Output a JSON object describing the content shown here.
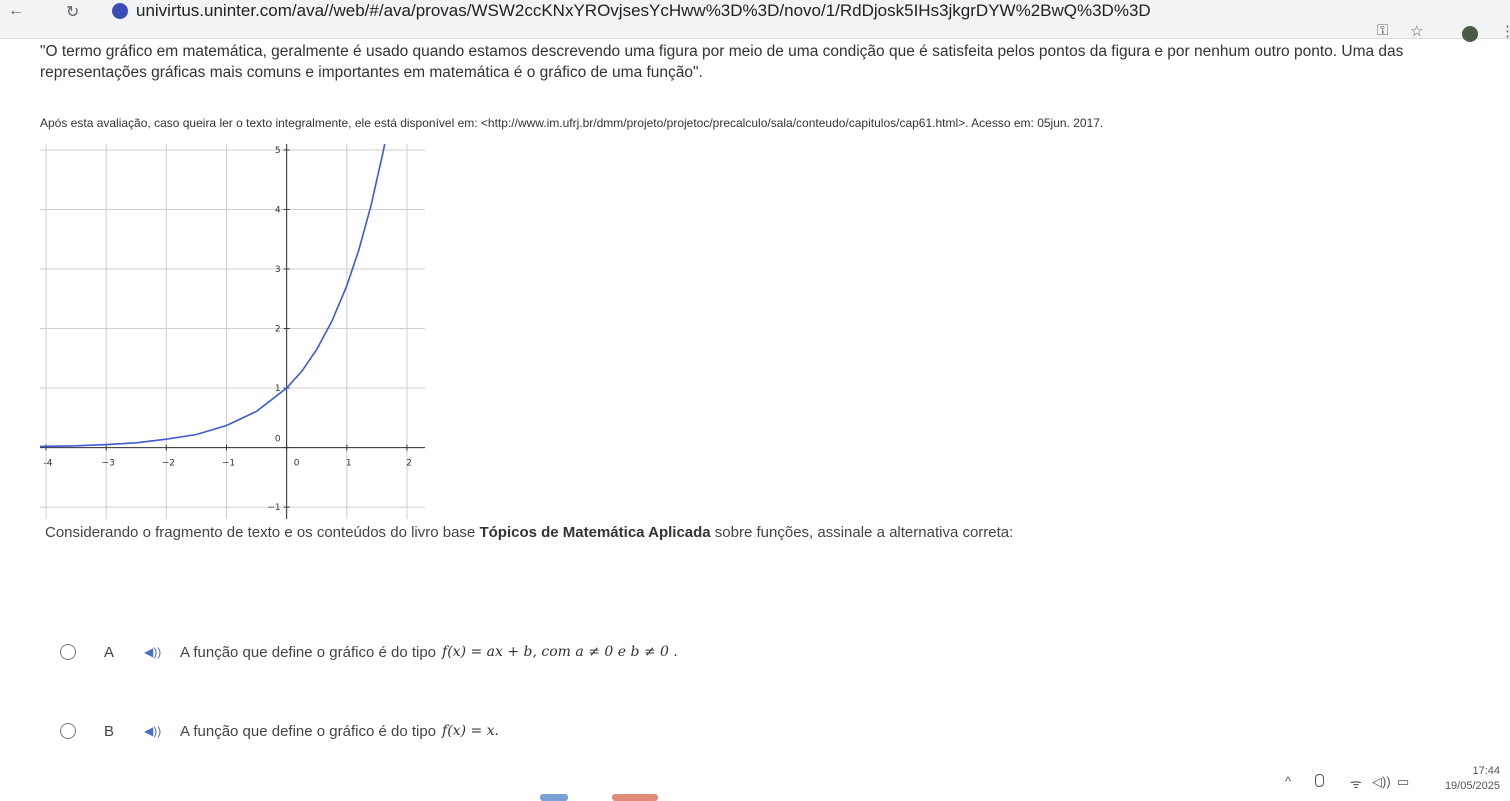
{
  "browser": {
    "url": "univirtus.uninter.com/ava//web/#/ava/provas/WSW2ccKNxYROvjsesYcHww%3D%3D/novo/1/RdDjosk5IHs3jkgrDYW%2BwQ%3D%3D",
    "back_icon": "←",
    "reload_icon": "↻",
    "key_icon": "⚿",
    "star_icon": "☆",
    "menu_icon": "⋮"
  },
  "intro": {
    "quote": "\"O termo gráfico em matemática, geralmente é usado quando estamos descrevendo uma figura por meio de uma condição que é satisfeita pelos pontos da figura e por nenhum outro ponto. Uma das representações gráficas mais comuns e importantes em matemática é o gráfico de uma função\".",
    "source": "Após esta avaliação, caso queira ler o texto integralmente, ele está disponível em: <http://www.im.ufrj.br/dmm/projeto/projetoc/precalculo/sala/conteudo/capitulos/cap61.html>. Acesso em: 05jun. 2017."
  },
  "graph": {
    "x_ticks": [
      {
        "value": -4,
        "label": "-4"
      },
      {
        "value": -3,
        "label": "−3"
      },
      {
        "value": -2,
        "label": "−2"
      },
      {
        "value": -1,
        "label": "−1"
      },
      {
        "value": 0,
        "label": "0"
      },
      {
        "value": 1,
        "label": "1"
      },
      {
        "value": 2,
        "label": "2"
      }
    ],
    "y_ticks": [
      {
        "value": -1,
        "label": "−1"
      },
      {
        "value": 0,
        "label": "0"
      },
      {
        "value": 1,
        "label": "1"
      },
      {
        "value": 2,
        "label": "2"
      },
      {
        "value": 3,
        "label": "3"
      },
      {
        "value": 4,
        "label": "4"
      },
      {
        "value": 5,
        "label": "5"
      }
    ],
    "xlim": [
      -4.1,
      2.3
    ],
    "ylim": [
      -1.2,
      5.1
    ],
    "curve_color": "#3d5bd6",
    "curve_samples": [
      {
        "x": -4.1,
        "y": 0.02
      },
      {
        "x": -3.5,
        "y": 0.03
      },
      {
        "x": -3.0,
        "y": 0.05
      },
      {
        "x": -2.5,
        "y": 0.08
      },
      {
        "x": -2.0,
        "y": 0.14
      },
      {
        "x": -1.5,
        "y": 0.22
      },
      {
        "x": -1.0,
        "y": 0.37
      },
      {
        "x": -0.5,
        "y": 0.61
      },
      {
        "x": 0.0,
        "y": 1.0
      },
      {
        "x": 0.25,
        "y": 1.28
      },
      {
        "x": 0.5,
        "y": 1.65
      },
      {
        "x": 0.75,
        "y": 2.12
      },
      {
        "x": 1.0,
        "y": 2.72
      },
      {
        "x": 1.2,
        "y": 3.32
      },
      {
        "x": 1.4,
        "y": 4.06
      },
      {
        "x": 1.6,
        "y": 4.95
      },
      {
        "x": 1.63,
        "y": 5.1
      }
    ]
  },
  "question": {
    "prefix": "Considerando o fragmento de texto e os conteúdos do livro base ",
    "book": "Tópicos de Matemática Aplicada",
    "suffix": " sobre funções, assinale a alternativa correta:"
  },
  "options": [
    {
      "letter": "A",
      "speaker": "◀))",
      "text": "A função que define o gráfico é do tipo",
      "formula": "f(x) = ax + b, com a ≠ 0 e b ≠ 0 ."
    },
    {
      "letter": "B",
      "speaker": "◀))",
      "text": "A função que define o gráfico é do tipo",
      "formula": "f(x) = x."
    }
  ],
  "taskbar": {
    "time": "17:44",
    "date": "19/05/2025",
    "chevron_icon": "^",
    "wifi_icon": "ᯤ",
    "volume_icon": "◁))",
    "battery_icon": "▭"
  }
}
